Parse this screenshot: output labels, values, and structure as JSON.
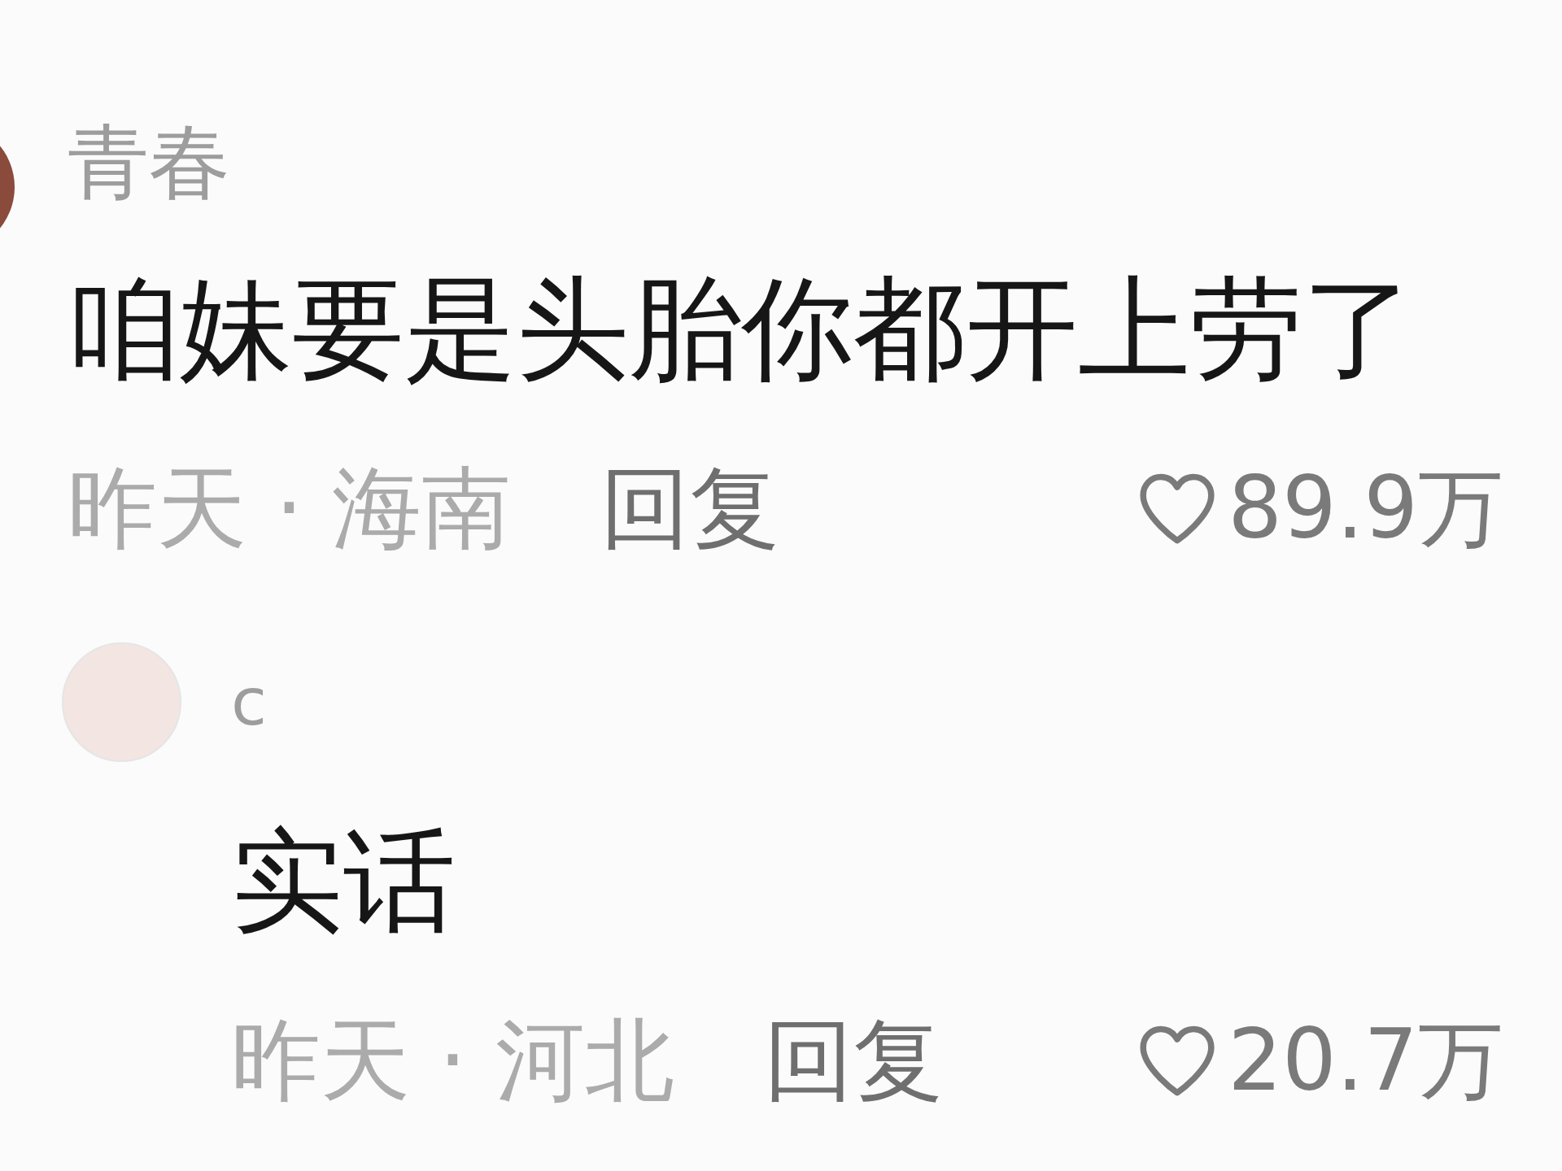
{
  "comments": [
    {
      "username": "青春",
      "text": "咱妹要是头胎你都开上劳了",
      "meta": "昨天 · 海南",
      "reply_label": "回复",
      "likes": "89.9万",
      "replies": [
        {
          "username": "c",
          "text": "实话",
          "meta": "昨天 · 河北",
          "reply_label": "回复",
          "likes": "20.7万"
        }
      ]
    }
  ]
}
